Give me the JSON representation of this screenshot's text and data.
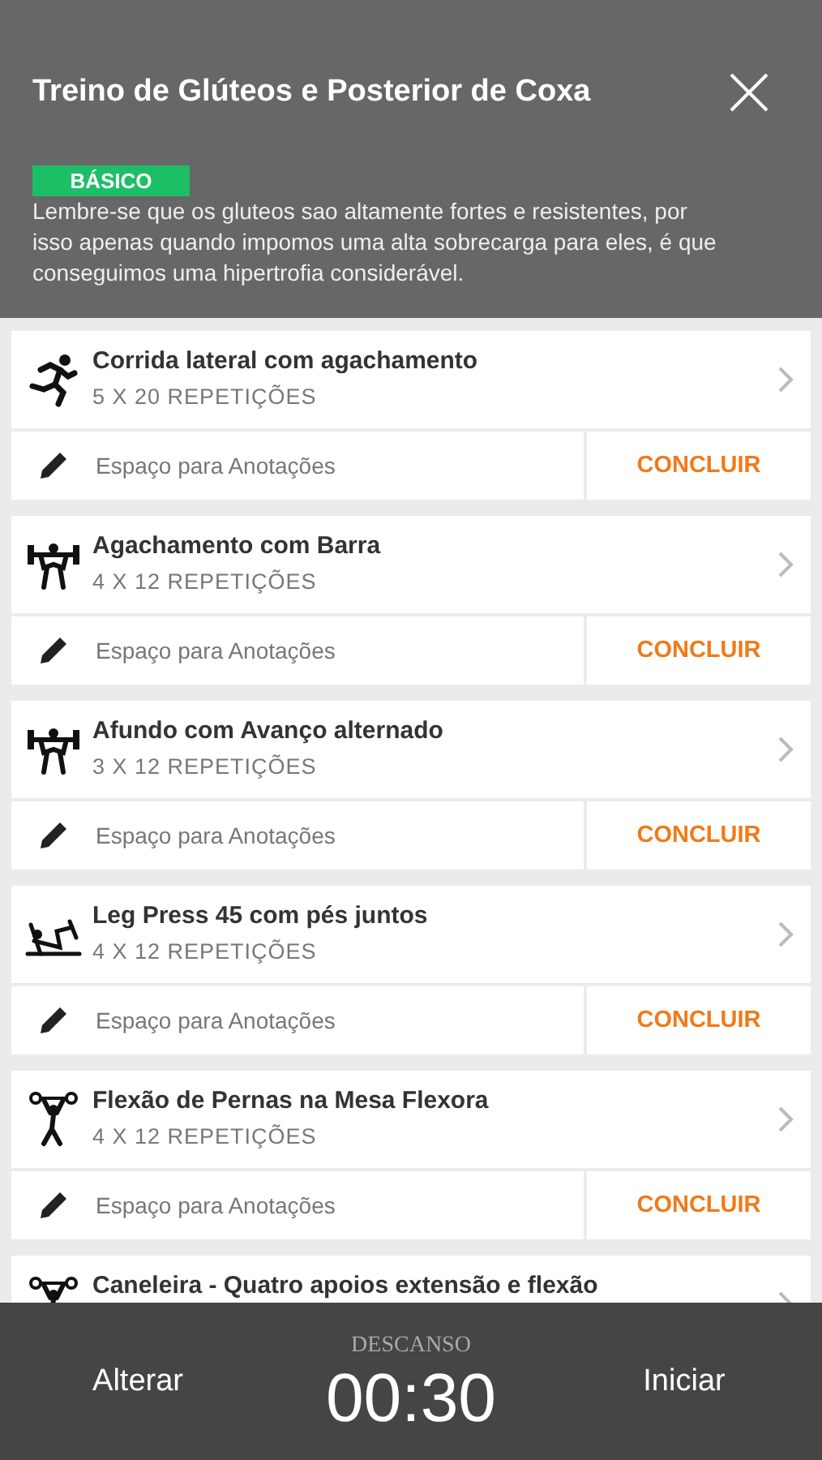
{
  "header": {
    "title": "Treino de Glúteos e Posterior de Coxa",
    "level_badge": "BÁSICO",
    "description": "Lembre-se que os gluteos sao altamente fortes e resistentes, por isso apenas quando impomos uma alta sobrecarga para eles, é que conseguimos uma hipertrofia considerável."
  },
  "exercises": [
    {
      "kind": "runner",
      "name": "Corrida lateral com agachamento",
      "reps": "5 X 20 REPETIÇÕES",
      "notes_placeholder": "Espaço para Anotações",
      "action": "CONCLUIR"
    },
    {
      "kind": "barbell",
      "name": "Agachamento com Barra",
      "reps": "4 X 12 REPETIÇÕES",
      "notes_placeholder": "Espaço para Anotações",
      "action": "CONCLUIR"
    },
    {
      "kind": "barbell",
      "name": "Afundo com Avanço alternado",
      "reps": "3 X 12 REPETIÇÕES",
      "notes_placeholder": "Espaço para Anotações",
      "action": "CONCLUIR"
    },
    {
      "kind": "legpress",
      "name": "Leg Press 45 com pés juntos",
      "reps": "4 X 12 REPETIÇÕES",
      "notes_placeholder": "Espaço para Anotações",
      "action": "CONCLUIR"
    },
    {
      "kind": "overhead",
      "name": "Flexão de Pernas na Mesa Flexora",
      "reps": "4 X 12 REPETIÇÕES",
      "notes_placeholder": "Espaço para Anotações",
      "action": "CONCLUIR"
    },
    {
      "kind": "overhead",
      "name": "Caneleira - Quatro apoios extensão e flexão"
    }
  ],
  "rest_bar": {
    "label": "DESCANSO",
    "time": "00:30",
    "left_button": "Alterar",
    "right_button": "Iniciar"
  }
}
